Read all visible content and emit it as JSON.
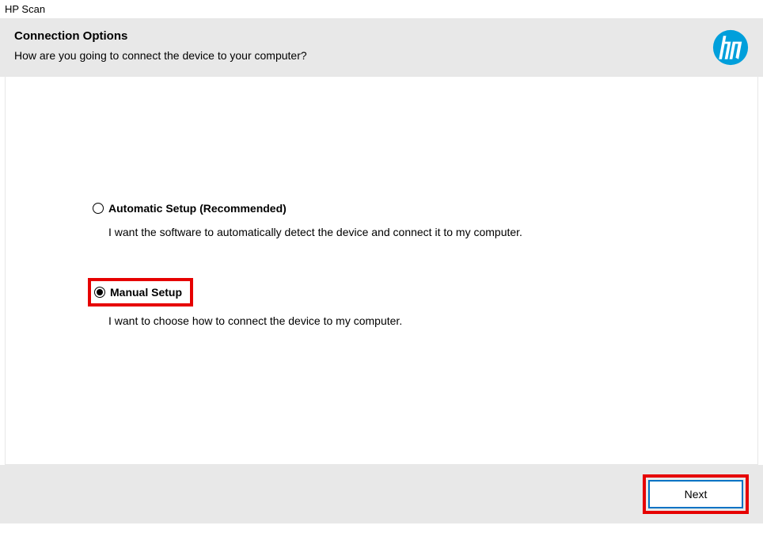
{
  "window_title": "HP Scan",
  "header": {
    "title": "Connection Options",
    "subtitle": "How are you going to connect the device to your computer?"
  },
  "options": {
    "automatic": {
      "label": "Automatic Setup (Recommended)",
      "description": "I want the software to automatically detect the device and connect it to my computer.",
      "selected": false
    },
    "manual": {
      "label": "Manual Setup",
      "description": "I want to choose how to connect the device to my computer.",
      "selected": true
    }
  },
  "footer": {
    "next_label": "Next"
  }
}
